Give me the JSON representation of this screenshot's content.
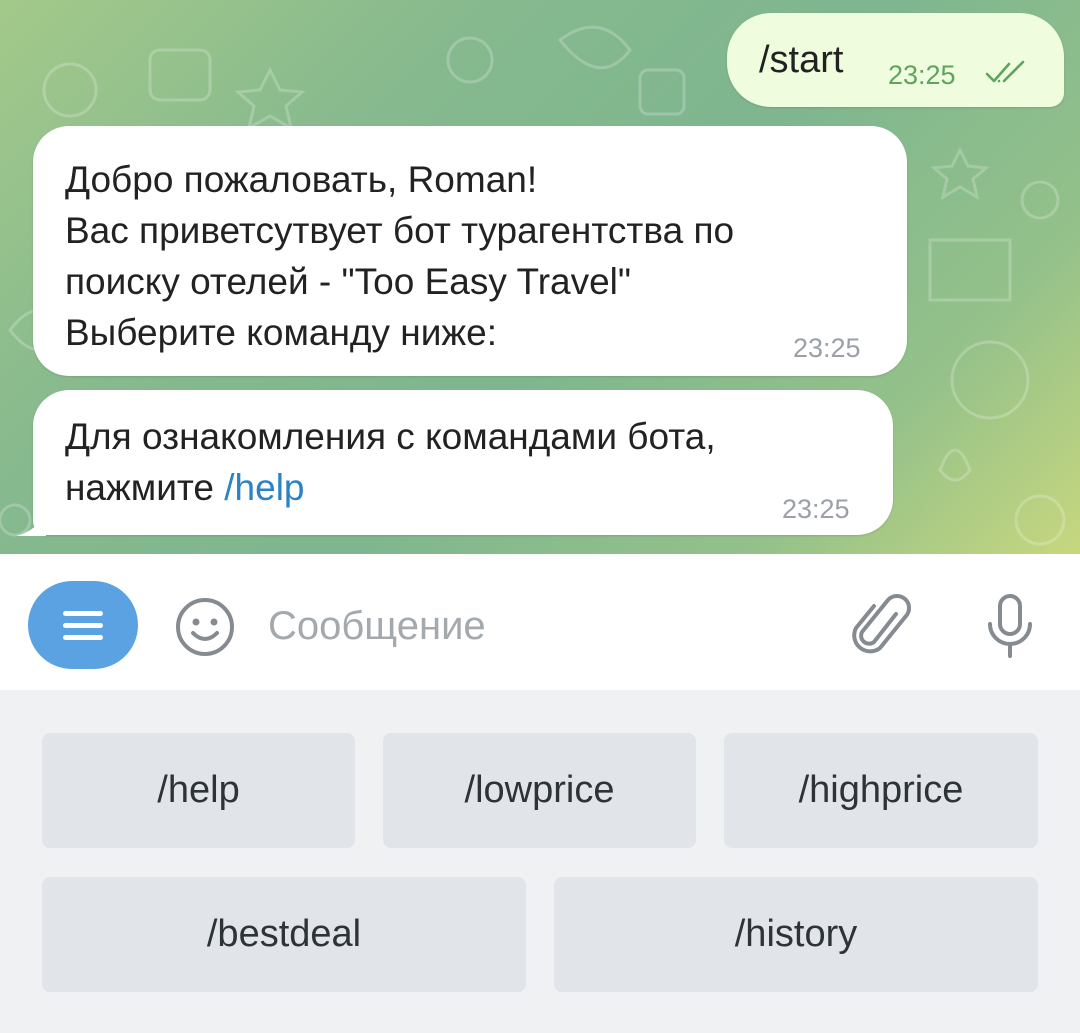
{
  "messages": {
    "outgoing": {
      "text": "/start",
      "time": "23:25",
      "status_icon": "double-check-icon"
    },
    "welcome": {
      "lines": [
        "Добро пожаловать, Roman!",
        "Вас приветсутвует бот турагентства по",
        "поиску отелей - \"Too Easy Travel\"",
        "Выберите команду ниже:"
      ],
      "time": "23:25"
    },
    "help_hint": {
      "line1": "Для ознакомления с командами бота,",
      "line2_prefix": "нажмите ",
      "line2_link": "/help",
      "time": "23:25"
    }
  },
  "composer": {
    "placeholder": "Сообщение",
    "value": "",
    "icons": [
      "menu-icon",
      "emoji-icon",
      "paperclip-icon",
      "microphone-icon"
    ]
  },
  "keyboard": {
    "row1": [
      "/help",
      "/lowprice",
      "/highprice"
    ],
    "row2": [
      "/bestdeal",
      "/history"
    ]
  },
  "colors": {
    "outgoing_bubble": "#effdde",
    "incoming_bubble": "#ffffff",
    "link": "#2b83c6",
    "menu_button": "#5aa2e2",
    "keyboard_button": "#e1e5e9"
  }
}
